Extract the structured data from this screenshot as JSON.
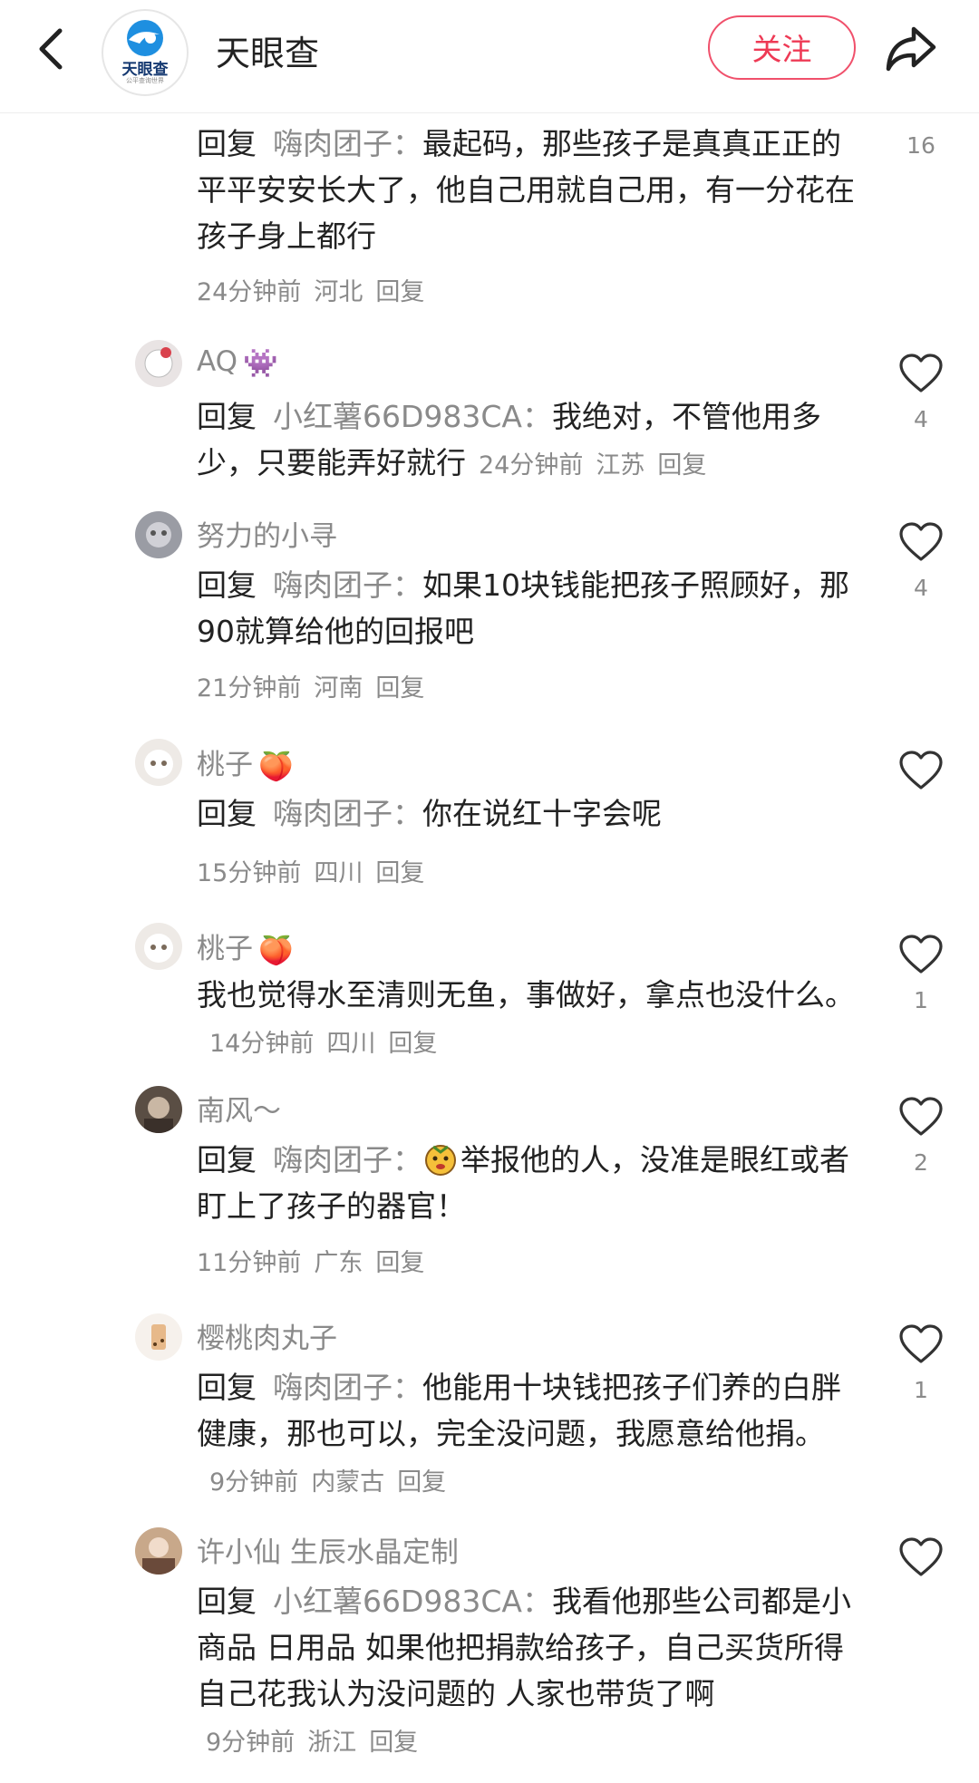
{
  "header": {
    "title": "天眼查",
    "logo_text": "天眼查",
    "logo_sub": "公平查询世界",
    "follow_label": "关注"
  },
  "comments": [
    {
      "reply_word": "回复",
      "mention": "嗨肉团子：",
      "text": "最起码，那些孩子是真真正正的平平安安长大了，他自己用就自己用，有一分花在孩子身上都行",
      "time": "24分钟前",
      "location": "河北",
      "reply_label": "回复",
      "likes": "16"
    },
    {
      "user": "AQ",
      "user_emoji": "👾",
      "reply_word": "回复",
      "mention": "小红薯66D983CA：",
      "text": "我绝对，不管他用多少，只要能弄好就行",
      "time": "24分钟前",
      "location": "江苏",
      "reply_label": "回复",
      "likes": "4"
    },
    {
      "user": "努力的小寻",
      "reply_word": "回复",
      "mention": "嗨肉团子：",
      "text": "如果10块钱能把孩子照顾好，那90就算给他的回报吧",
      "time": "21分钟前",
      "location": "河南",
      "reply_label": "回复",
      "likes": "4"
    },
    {
      "user": "桃子",
      "user_emoji": "🍑",
      "reply_word": "回复",
      "mention": "嗨肉团子：",
      "text": "你在说红十字会呢",
      "time": "15分钟前",
      "location": "四川",
      "reply_label": "回复",
      "likes": ""
    },
    {
      "user": "桃子",
      "user_emoji": "🍑",
      "text": "我也觉得水至清则无鱼，事做好，拿点也没什么。",
      "time": "14分钟前",
      "location": "四川",
      "reply_label": "回复",
      "likes": "1"
    },
    {
      "user": "南风～",
      "reply_word": "回复",
      "mention": "嗨肉团子：",
      "text": "举报他的人，没准是眼红或者盯上了孩子的器官！",
      "time": "11分钟前",
      "location": "广东",
      "reply_label": "回复",
      "likes": "2"
    },
    {
      "user": "樱桃肉丸子",
      "reply_word": "回复",
      "mention": "嗨肉团子：",
      "text": "他能用十块钱把孩子们养的白胖健康，那也可以，完全没问题，我愿意给他捐。",
      "time": "9分钟前",
      "location": "内蒙古",
      "reply_label": "回复",
      "likes": "1"
    },
    {
      "user": "许小仙 生辰水晶定制",
      "reply_word": "回复",
      "mention": "小红薯66D983CA：",
      "text": "我看他那些公司都是小商品 日用品 如果他把捐款给孩子，自己买货所得 自己花我认为没问题的 人家也带货了啊",
      "time": "9分钟前",
      "location": "浙江",
      "reply_label": "回复",
      "likes": ""
    }
  ],
  "colors": {
    "accent": "#ee3a55",
    "muted_text": "#8a8a8a",
    "body_text": "#222222"
  },
  "icons": [
    "back-arrow-icon",
    "share-arrow-icon",
    "heart-icon"
  ]
}
